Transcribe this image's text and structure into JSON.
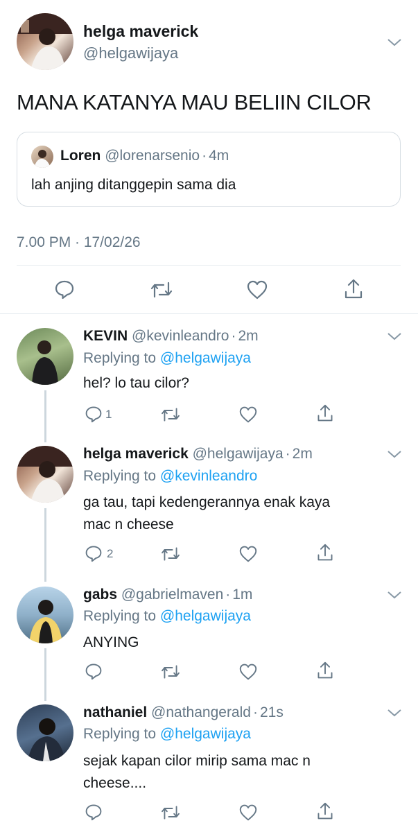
{
  "main_tweet": {
    "display_name": "helga maverick",
    "handle": "@helgawijaya",
    "text": "MANA KATANYA MAU BELIIN CILOR",
    "quoted": {
      "display_name": "Loren",
      "handle": "@lorenarsenio",
      "separator": "·",
      "time": "4m",
      "text": "lah anjing ditanggepin sama dia"
    },
    "timestamp": "7.00 PM · 17/02/26",
    "icons": [
      "reply-icon",
      "retweet-icon",
      "like-icon",
      "share-icon"
    ]
  },
  "replying_label": "Replying to",
  "replies": [
    {
      "display_name": "KEVIN",
      "handle": "@kevinleandro",
      "separator": "·",
      "time": "2m",
      "replying_to": "@helgawijaya",
      "text_lines": [
        "hel? lo tau cilor?"
      ],
      "reply_count": "1"
    },
    {
      "display_name": "helga maverick",
      "handle": "@helgawijaya",
      "separator": "·",
      "time": "2m",
      "replying_to": "@kevinleandro",
      "text_lines": [
        "ga tau, tapi kedengerannya enak kaya",
        "mac n cheese"
      ],
      "reply_count": "2"
    },
    {
      "display_name": "gabs",
      "handle": "@gabrielmaven",
      "separator": "·",
      "time": "1m",
      "replying_to": "@helgawijaya",
      "text_lines": [
        "ANYING"
      ],
      "reply_count": ""
    },
    {
      "display_name": "nathaniel",
      "handle": "@nathangerald",
      "separator": "·",
      "time": "21s",
      "replying_to": "@helgawijaya",
      "text_lines": [
        "sejak kapan cilor mirip sama mac n",
        "cheese...."
      ],
      "reply_count": ""
    }
  ],
  "colors": {
    "accent": "#1da1f2",
    "secondary_text": "#657786",
    "divider": "#e6ecf0",
    "thread_line": "#ccd6dd"
  }
}
